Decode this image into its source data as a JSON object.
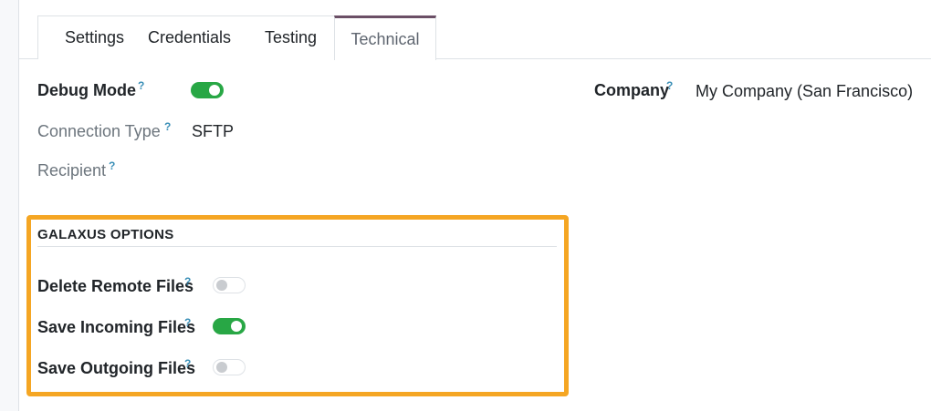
{
  "tabs": [
    {
      "label": "Settings",
      "active": false
    },
    {
      "label": "Credentials",
      "active": false
    },
    {
      "label": "Testing",
      "active": false
    },
    {
      "label": "Technical",
      "active": true
    }
  ],
  "fields": {
    "debug_mode": {
      "label": "Debug Mode",
      "help": "?",
      "enabled": true
    },
    "connection_type": {
      "label": "Connection Type",
      "help": "?",
      "value": "SFTP"
    },
    "recipient": {
      "label": "Recipient",
      "help": "?",
      "value": ""
    },
    "company": {
      "label": "Company",
      "help": "?",
      "value": "My Company (San Francisco)"
    }
  },
  "galaxus_options": {
    "title": "GALAXUS OPTIONS",
    "delete_remote_files": {
      "label": "Delete Remote Files",
      "help": "?",
      "enabled": false
    },
    "save_incoming_files": {
      "label": "Save Incoming Files",
      "help": "?",
      "enabled": true
    },
    "save_outgoing_files": {
      "label": "Save Outgoing Files",
      "help": "?",
      "enabled": false
    }
  },
  "colors": {
    "toggle_on": "#28a745",
    "active_tab_accent": "#6b4f66",
    "highlight_border": "#f5a623",
    "help_mark": "#3a8fb7"
  }
}
